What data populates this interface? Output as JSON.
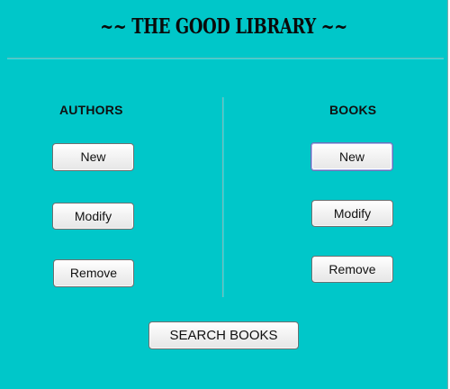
{
  "window": {
    "title": "~~ THE GOOD LIBRARY ~~"
  },
  "authors": {
    "heading": "AUTHORS",
    "new_label": "New",
    "modify_label": "Modify",
    "remove_label": "Remove"
  },
  "books": {
    "heading": "BOOKS",
    "new_label": "New",
    "modify_label": "Modify",
    "remove_label": "Remove"
  },
  "search": {
    "label": "SEARCH BOOKS"
  },
  "colors": {
    "background": "#00c7c9",
    "button_face": "#f2f2f2",
    "focus_border": "#6a72b8"
  }
}
